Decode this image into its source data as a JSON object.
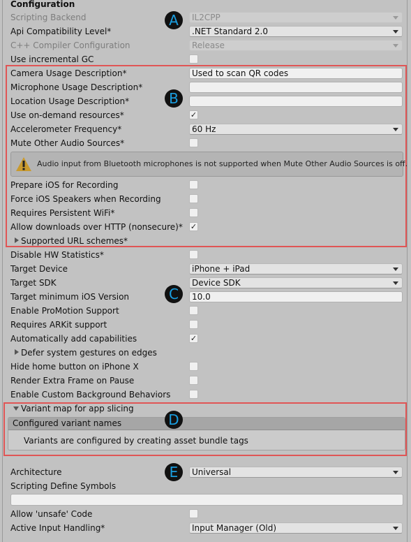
{
  "section_title": "Configuration",
  "badges": {
    "a": "A",
    "b": "B",
    "c": "C",
    "d": "D",
    "e": "E"
  },
  "rows": {
    "scripting_backend": {
      "label": "Scripting Backend",
      "value": "IL2CPP"
    },
    "api_compat": {
      "label": "Api Compatibility Level*",
      "value": ".NET Standard 2.0"
    },
    "cpp_compiler": {
      "label": "C++ Compiler Configuration",
      "value": "Release"
    },
    "incremental_gc": {
      "label": "Use incremental GC",
      "checked": "false"
    },
    "camera_usage": {
      "label": "Camera Usage Description*",
      "value": "Used to scan QR codes"
    },
    "microphone_usage": {
      "label": "Microphone Usage Description*",
      "value": ""
    },
    "location_usage": {
      "label": "Location Usage Description*",
      "value": ""
    },
    "on_demand": {
      "label": "Use on-demand resources*",
      "checked": "true",
      "mark": "✓"
    },
    "accelerometer": {
      "label": "Accelerometer Frequency*",
      "value": "60 Hz"
    },
    "mute_audio": {
      "label": "Mute Other Audio Sources*",
      "checked": "false"
    },
    "prepare_recording": {
      "label": "Prepare iOS for Recording",
      "checked": "false"
    },
    "force_speakers": {
      "label": "Force iOS Speakers when Recording",
      "checked": "false"
    },
    "persistent_wifi": {
      "label": "Requires Persistent WiFi*",
      "checked": "false"
    },
    "allow_http": {
      "label": "Allow downloads over HTTP (nonsecure)*",
      "checked": "true",
      "mark": "✓"
    },
    "url_schemes": {
      "label": "Supported URL schemes*"
    },
    "disable_hw_stats": {
      "label": "Disable HW Statistics*",
      "checked": "false"
    },
    "target_device": {
      "label": "Target Device",
      "value": "iPhone + iPad"
    },
    "target_sdk": {
      "label": "Target SDK",
      "value": "Device SDK"
    },
    "min_ios": {
      "label": "Target minimum iOS Version",
      "value": "10.0"
    },
    "promotion": {
      "label": "Enable ProMotion Support",
      "checked": "false"
    },
    "arkit": {
      "label": "Requires ARKit support",
      "checked": "false"
    },
    "auto_capabilities": {
      "label": "Automatically add capabilities",
      "checked": "true",
      "mark": "✓"
    },
    "defer_gestures": {
      "label": "Defer system gestures on edges"
    },
    "hide_home": {
      "label": "Hide home button on iPhone X",
      "checked": "false"
    },
    "extra_frame": {
      "label": "Render Extra Frame on Pause",
      "checked": "false"
    },
    "custom_bg": {
      "label": "Enable Custom Background Behaviors",
      "checked": "false"
    },
    "variant_map": {
      "label": "Variant map for app slicing"
    },
    "architecture": {
      "label": "Architecture",
      "value": "Universal"
    },
    "define_symbols": {
      "label": "Scripting Define Symbols",
      "value": ""
    },
    "unsafe_code": {
      "label": "Allow 'unsafe' Code",
      "checked": "false"
    },
    "input_handling": {
      "label": "Active Input Handling*",
      "value": "Input Manager (Old)"
    }
  },
  "warning": {
    "icon": "warning-icon",
    "message": "Audio input from Bluetooth microphones is not supported when Mute Other Audio Sources is off."
  },
  "variants": {
    "header": "Configured variant names",
    "body": "Variants are configured by creating asset bundle tags"
  },
  "colors": {
    "highlight": "#e05555",
    "badge_bg": "#111111",
    "badge_fg": "#1a9ee0",
    "warning": "#c99a2e"
  }
}
